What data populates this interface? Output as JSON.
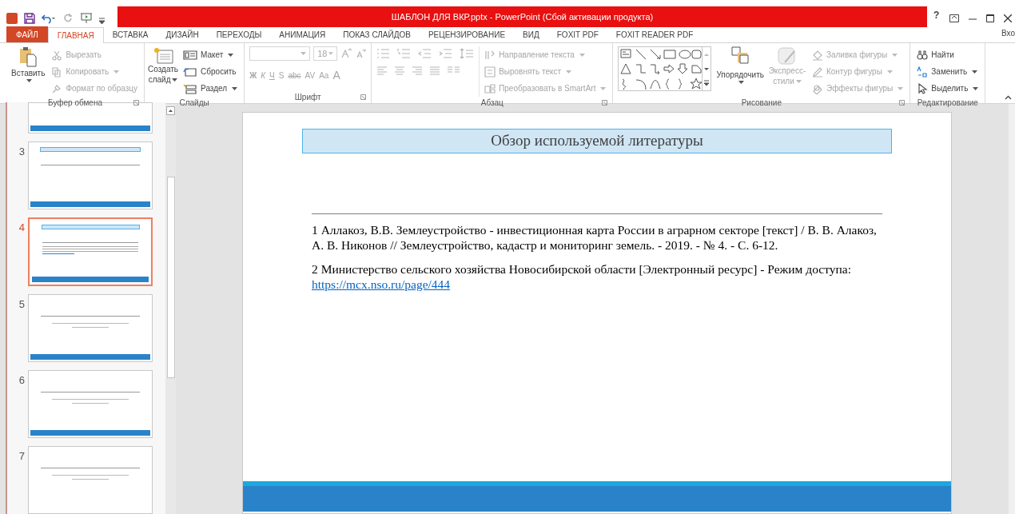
{
  "window": {
    "title": "ШАБЛОН ДЛЯ ВКР.pptx - PowerPoint (Сбой активации продукта)",
    "help": "?",
    "sign_in": "Вхо"
  },
  "tabs": [
    {
      "label": "ФАЙЛ",
      "kind": "file",
      "selected": false
    },
    {
      "label": "ГЛАВНАЯ",
      "kind": "tab",
      "selected": true
    },
    {
      "label": "ВСТАВКА",
      "kind": "tab",
      "selected": false
    },
    {
      "label": "ДИЗАЙН",
      "kind": "tab",
      "selected": false
    },
    {
      "label": "ПЕРЕХОДЫ",
      "kind": "tab",
      "selected": false
    },
    {
      "label": "АНИМАЦИЯ",
      "kind": "tab",
      "selected": false
    },
    {
      "label": "ПОКАЗ СЛАЙДОВ",
      "kind": "tab",
      "selected": false
    },
    {
      "label": "РЕЦЕНЗИРОВАНИЕ",
      "kind": "tab",
      "selected": false
    },
    {
      "label": "ВИД",
      "kind": "tab",
      "selected": false
    },
    {
      "label": "FOXIT PDF",
      "kind": "tab",
      "selected": false
    },
    {
      "label": "FOXIT READER PDF",
      "kind": "tab",
      "selected": false
    }
  ],
  "ribbon": {
    "clipboard": {
      "label": "Буфер обмена",
      "paste": {
        "label": "Вставить",
        "disabled": false
      },
      "items": [
        {
          "label": "Вырезать",
          "disabled": true
        },
        {
          "label": "Копировать",
          "disabled": true
        },
        {
          "label": "Формат по образцу",
          "disabled": true
        }
      ]
    },
    "slides": {
      "label": "Слайды",
      "new_slide": {
        "label": "Создать слайд",
        "disabled": false
      },
      "items": [
        {
          "label": "Макет",
          "disabled": false
        },
        {
          "label": "Сбросить",
          "disabled": false
        },
        {
          "label": "Раздел",
          "disabled": false
        }
      ]
    },
    "font": {
      "label": "Шрифт",
      "size": "18",
      "disabled": true,
      "glyphs": [
        {
          "label": "Ж"
        },
        {
          "label": "К"
        },
        {
          "label": "Ч"
        },
        {
          "label": "S"
        },
        {
          "label": "abc"
        },
        {
          "label": "AV"
        },
        {
          "label": "Aa"
        },
        {
          "label": "A"
        }
      ]
    },
    "paragraph": {
      "label": "Абзац",
      "items": [
        {
          "label": "Направление текста",
          "disabled": true
        },
        {
          "label": "Выровнять текст",
          "disabled": true
        },
        {
          "label": "Преобразовать в SmartArt",
          "disabled": true
        }
      ]
    },
    "drawing": {
      "label": "Рисование",
      "arrange": {
        "label": "Упорядочить",
        "disabled": false
      },
      "styles": {
        "label": "Экспресс-стили",
        "disabled": true
      },
      "items": [
        {
          "label": "Заливка фигуры",
          "disabled": true
        },
        {
          "label": "Контур фигуры",
          "disabled": true
        },
        {
          "label": "Эффекты фигуры",
          "disabled": true
        }
      ]
    },
    "editing": {
      "label": "Редактирование",
      "items": [
        {
          "label": "Найти",
          "disabled": false
        },
        {
          "label": "Заменить",
          "disabled": false
        },
        {
          "label": "Выделить",
          "disabled": false
        }
      ]
    }
  },
  "thumbnails": [
    {
      "kind": "partial",
      "selected": false
    },
    {
      "number": "3",
      "kind": "title_box",
      "selected": false
    },
    {
      "number": "4",
      "kind": "title_box",
      "selected": true
    },
    {
      "number": "5",
      "kind": "caption",
      "selected": false
    },
    {
      "number": "6",
      "kind": "caption",
      "selected": false
    },
    {
      "number": "7",
      "kind": "caption",
      "selected": false
    }
  ],
  "slide": {
    "title": "Обзор используемой литературы",
    "references": [
      {
        "text": "1 Аллакоз, В.В. Землеустройство - инвестиционная карта России в аграрном секторе [текст] / В. В. Алакоз, А. В. Никонов // Землеустройство, кадастр и мониторинг земель. - 2019. - № 4. - С. 6-12."
      },
      {
        "text": "2 Министерство сельского хозяйства Новосибирской области [Электронный ресурс] - Режим доступа:",
        "link": "https://mcx.nso.ru/page/444"
      }
    ]
  }
}
